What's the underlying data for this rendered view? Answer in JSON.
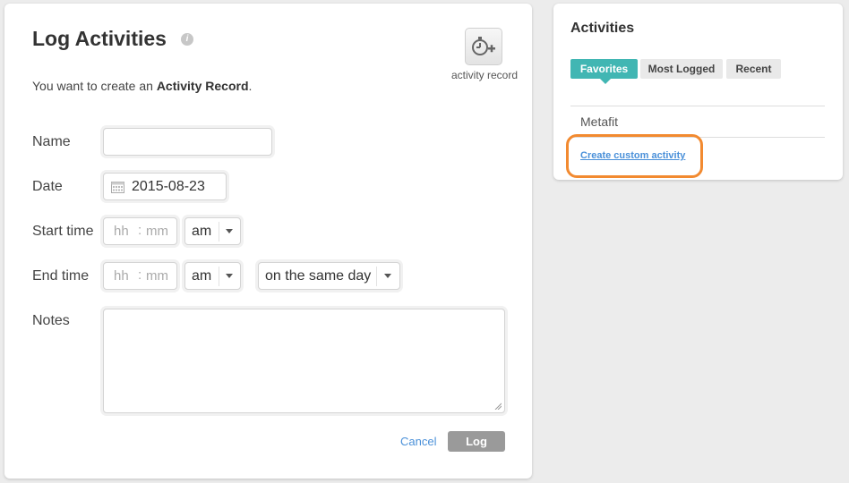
{
  "log": {
    "title": "Log Activities",
    "info_glyph": "i",
    "activity_record_label": "activity record",
    "intro_prefix": "You want to create an ",
    "intro_bold": "Activity Record",
    "intro_suffix": ".",
    "fields": {
      "name_label": "Name",
      "name_value": "",
      "date_label": "Date",
      "date_value": "2015-08-23",
      "start_label": "Start time",
      "end_label": "End time",
      "notes_label": "Notes",
      "notes_value": ""
    },
    "time": {
      "hh": "hh",
      "colon": ":",
      "mm": "mm"
    },
    "start_ampm": "am",
    "end_ampm": "am",
    "end_day": "on the same day",
    "cancel_label": "Cancel",
    "log_label": "Log"
  },
  "activities": {
    "title": "Activities",
    "tabs": [
      "Favorites",
      "Most Logged",
      "Recent"
    ],
    "active_tab": "Favorites",
    "items": [
      "Metafit"
    ],
    "create_link": "Create custom activity"
  },
  "colors": {
    "accent": "#41b6b3",
    "link": "#4a90d9",
    "highlight": "#f28a30",
    "log_button": "#9a9a9a"
  },
  "icons": {
    "info": "info-icon",
    "activity_record": "stopwatch-plus-icon",
    "calendar": "calendar-icon",
    "dropdown": "chevron-down-icon",
    "resize": "resize-grip-icon"
  }
}
